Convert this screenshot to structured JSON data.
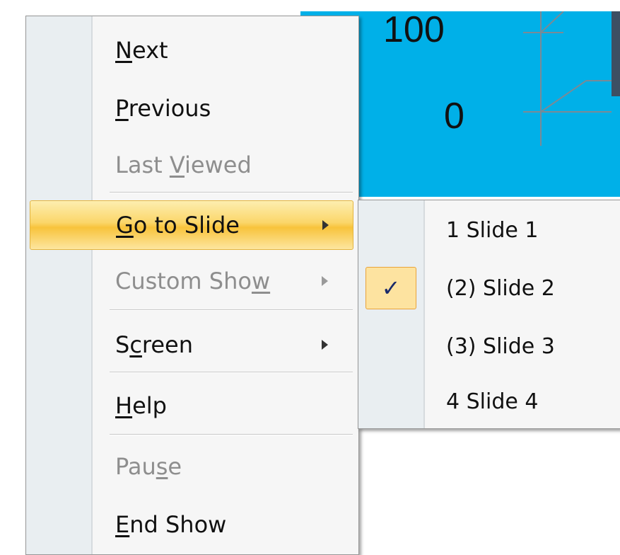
{
  "slide": {
    "value_top": "100",
    "value_bottom": "0",
    "background_color": "#00b0e8"
  },
  "context_menu": {
    "items": [
      {
        "label": "Next",
        "enabled": true
      },
      {
        "label": "Previous",
        "enabled": true
      },
      {
        "label": "Last Viewed",
        "enabled": false
      },
      {
        "label": "Go to Slide",
        "enabled": true,
        "submenu": true,
        "highlighted": true
      },
      {
        "label": "Custom Show",
        "enabled": false,
        "submenu": true
      },
      {
        "label": "Screen",
        "enabled": true,
        "submenu": true
      },
      {
        "label": "Help",
        "enabled": true
      },
      {
        "label": "Pause",
        "enabled": false
      },
      {
        "label": "End Show",
        "enabled": true
      }
    ],
    "highlight_color": "#fbd669"
  },
  "go_to_slide_submenu": {
    "items": [
      {
        "label": "1 Slide 1",
        "checked": false
      },
      {
        "label": "(2) Slide 2",
        "checked": true
      },
      {
        "label": "(3) Slide 3",
        "checked": false
      },
      {
        "label": "4 Slide 4",
        "checked": false
      }
    ],
    "check_icon": "checkmark-icon"
  }
}
